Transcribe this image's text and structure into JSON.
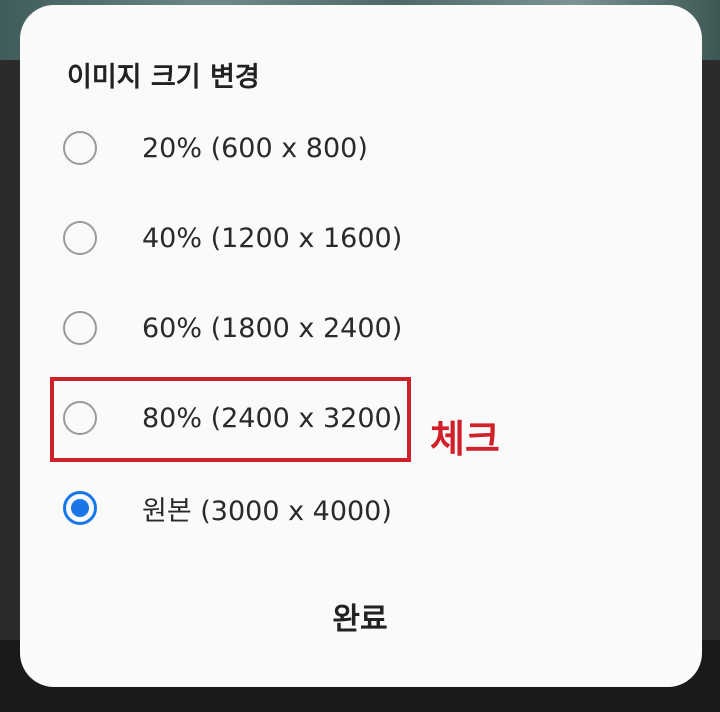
{
  "dialog": {
    "title": "이미지 크기 변경",
    "options": [
      {
        "label": "20% (600 x 800)",
        "selected": false
      },
      {
        "label": "40% (1200 x 1600)",
        "selected": false
      },
      {
        "label": "60% (1800 x 2400)",
        "selected": false
      },
      {
        "label": "80% (2400 x 3200)",
        "selected": false
      },
      {
        "label": "원본 (3000 x 4000)",
        "selected": true
      }
    ],
    "done_label": "완료"
  },
  "annotation": {
    "text": "체크",
    "color": "#d0202a"
  },
  "colors": {
    "accent": "#1976e8",
    "dialog_bg": "#fafafa"
  }
}
